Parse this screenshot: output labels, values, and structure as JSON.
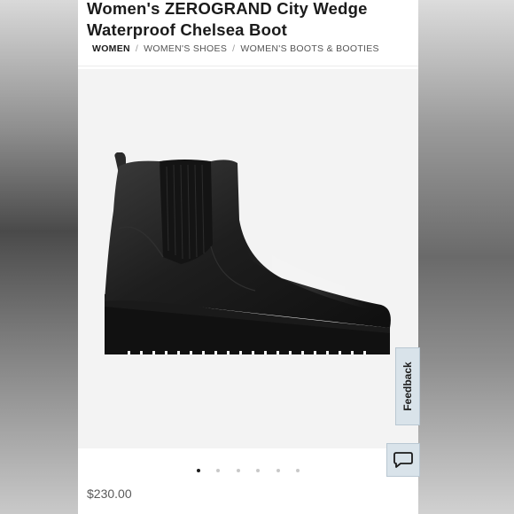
{
  "product": {
    "title_line1": "Women's ZEROGRAND City Wedge",
    "title_line2": "Waterproof Chelsea Boot",
    "price": "$230.00"
  },
  "breadcrumb": [
    "WOMEN",
    "WOMEN'S SHOES",
    "WOMEN'S BOOTS & BOOTIES"
  ],
  "breadcrumb_separator": "/",
  "gallery": {
    "image_count": 6,
    "active_index": 0
  },
  "feedback": {
    "label": "Feedback"
  },
  "icons": {
    "chat": "chat-bubble-icon"
  },
  "colors": {
    "text_primary": "#1b1b1b",
    "feedback_bg": "#d9e3ea",
    "dot_active": "#1b1b1b",
    "dot_inactive": "#c9c9c9"
  }
}
